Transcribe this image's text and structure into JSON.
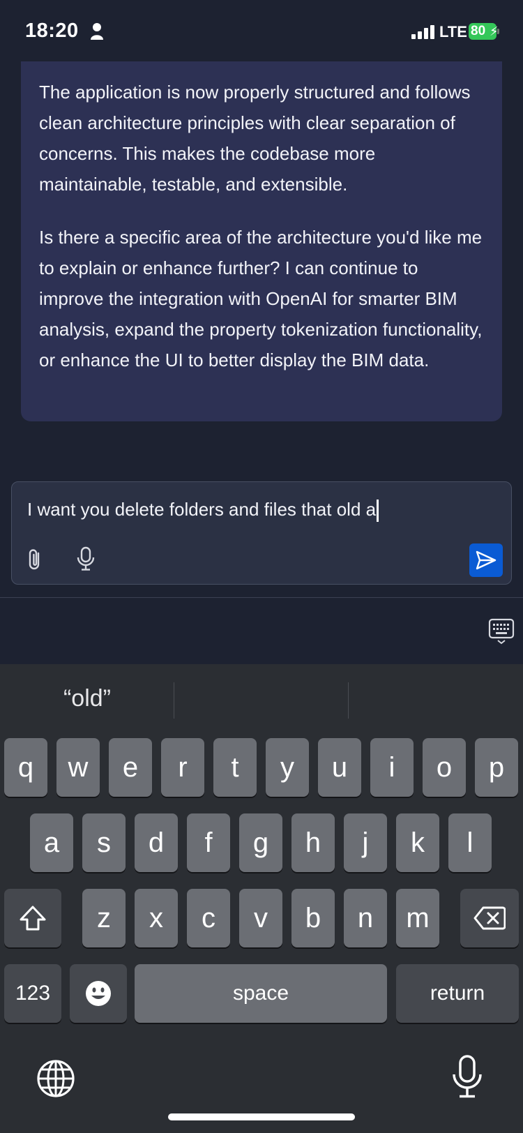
{
  "status_bar": {
    "time": "18:20",
    "network": "LTE",
    "battery_level": "80",
    "person_icon": "person-icon",
    "signal_icon": "signal-bars-icon"
  },
  "chat": {
    "message_paragraphs": [
      "The application is now properly structured and follows clean architecture principles with clear separation of concerns. This makes the codebase more maintainable, testable, and extensible.",
      "Is there a specific area of the architecture you'd like me to explain or enhance further? I can continue to improve the integration with OpenAI for smarter BIM analysis, expand the property tokenization functionality, or enhance the UI to better display the BIM data."
    ]
  },
  "composer": {
    "input_value": "I want you delete folders and files that old a",
    "attach_icon": "paperclip-icon",
    "mic_icon": "microphone-icon",
    "send_icon": "send-icon",
    "send_color": "#0a5bd4"
  },
  "keyboard": {
    "suggestion": "“old”",
    "row1": [
      "q",
      "w",
      "e",
      "r",
      "t",
      "y",
      "u",
      "i",
      "o",
      "p"
    ],
    "row2": [
      "a",
      "s",
      "d",
      "f",
      "g",
      "h",
      "j",
      "k",
      "l"
    ],
    "row3": [
      "z",
      "x",
      "c",
      "v",
      "b",
      "n",
      "m"
    ],
    "numbers_label": "123",
    "space_label": "space",
    "return_label": "return",
    "globe_icon": "globe-icon",
    "dictation_icon": "microphone-icon"
  }
}
